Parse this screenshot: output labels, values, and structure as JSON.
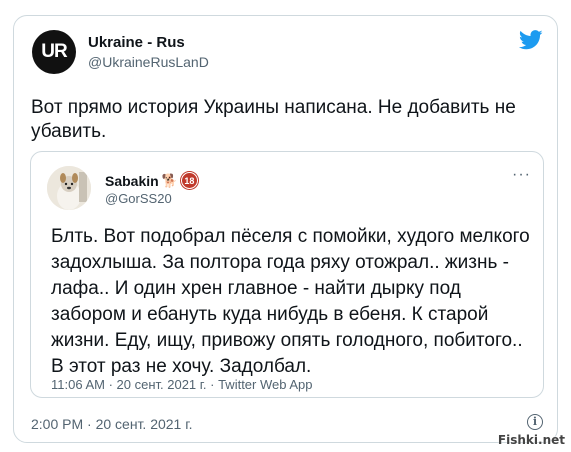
{
  "tweet": {
    "author_name": "Ukraine - Rus",
    "author_handle": "@UkraineRusLanD",
    "avatar_text": "UR",
    "text": "Вот прямо история Украины написана. Не добавить не убавить.",
    "timestamp": "2:00 PM · 20 сент. 2021 г."
  },
  "quoted_tweet": {
    "author_name": "Sabakin",
    "badge": "18",
    "author_handle": "@GorSS20",
    "text": "Блть. Вот подобрал пёселя с помойки, худого мелкого задохлыша. За полтора года ряху отожрал.. жизнь - лафа.. И один хрен главное - найти дырку под забором и ебануть куда нибудь в ебеня. К старой жизни. Еду, ищу, привожу опять голодного, побитого.. В этот раз не хочу. Задолбал.",
    "timestamp": "11:06 AM · 20 сент. 2021 г. · Twitter Web App"
  },
  "icons": {
    "twitter": "twitter-bird-icon",
    "dog": "dog-icon",
    "more": "more-icon",
    "info": "info-icon"
  },
  "colors": {
    "twitter_blue": "#1d9bf0",
    "text_primary": "#0f1419",
    "text_secondary": "#536471",
    "border": "#cfd9de",
    "badge_red": "#c0392b"
  },
  "watermark": "Fishki.net"
}
